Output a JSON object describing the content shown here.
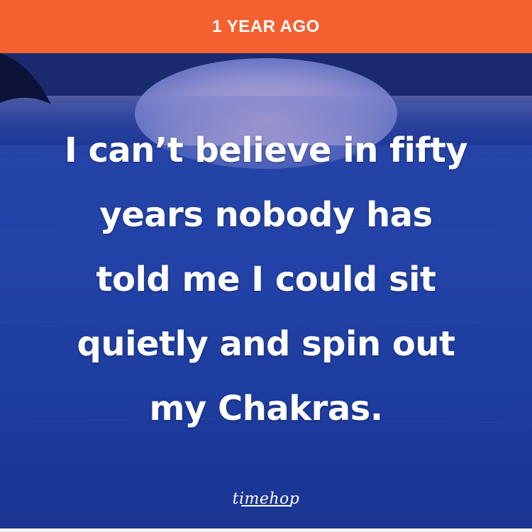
{
  "header": {
    "title": "1 YEAR AGO",
    "color": "#f4602f"
  },
  "memory": {
    "quote_lines": [
      "I can’t believe in fifty",
      "years nobody has",
      "told me I could sit",
      "quietly and spin out",
      "my Chakras."
    ],
    "background_colors": [
      "#1b2a73",
      "#1d3fa6",
      "#173189"
    ]
  },
  "watermark": {
    "text": "timehop"
  }
}
